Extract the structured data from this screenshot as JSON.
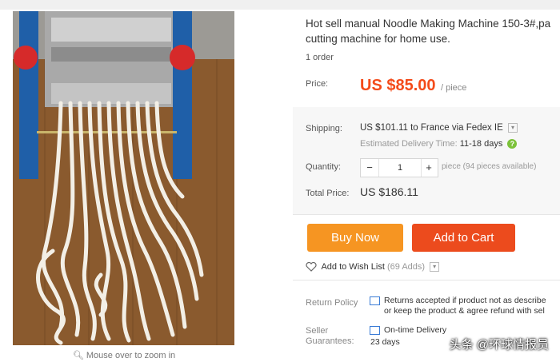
{
  "product": {
    "title": "Hot sell manual Noodle Making Machine 150-3#,pa\ncutting machine for home use.",
    "orders": "1 order",
    "image_alt": "noodle machine photo",
    "zoom_hint": "Mouse over to zoom in"
  },
  "price": {
    "label": "Price:",
    "value": "US $85.00",
    "unit": "/ piece"
  },
  "shipping": {
    "label": "Shipping:",
    "value": "US $101.11 to France via Fedex IE",
    "estimate_label": "Estimated Delivery Time:",
    "estimate_days": "11-18 days"
  },
  "quantity": {
    "label": "Quantity:",
    "minus": "−",
    "value": "1",
    "plus": "+",
    "note": "piece (94 pieces available)"
  },
  "total": {
    "label": "Total Price:",
    "value": "US $186.11"
  },
  "actions": {
    "buy_now": "Buy Now",
    "add_to_cart": "Add to Cart"
  },
  "wishlist": {
    "label": "Add to Wish List",
    "count": "(69 Adds)"
  },
  "return_policy": {
    "label": "Return Policy",
    "line1": "Returns accepted if product not as describe",
    "line2": "or keep the product & agree refund with sel"
  },
  "seller_guarantees": {
    "label_line1": "Seller",
    "label_line2": "Guarantees:",
    "line1": "On-time Delivery",
    "line2": "23 days"
  },
  "watermark": "头条 @环球情报员",
  "colors": {
    "price": "#f44b1a",
    "buy_now": "#f69522",
    "add_to_cart": "#ec4b1d",
    "help": "#7cc23a"
  },
  "icons": [
    "search-icon",
    "chevron-down-icon",
    "help-icon",
    "heart-icon",
    "return-icon",
    "delivery-icon"
  ]
}
